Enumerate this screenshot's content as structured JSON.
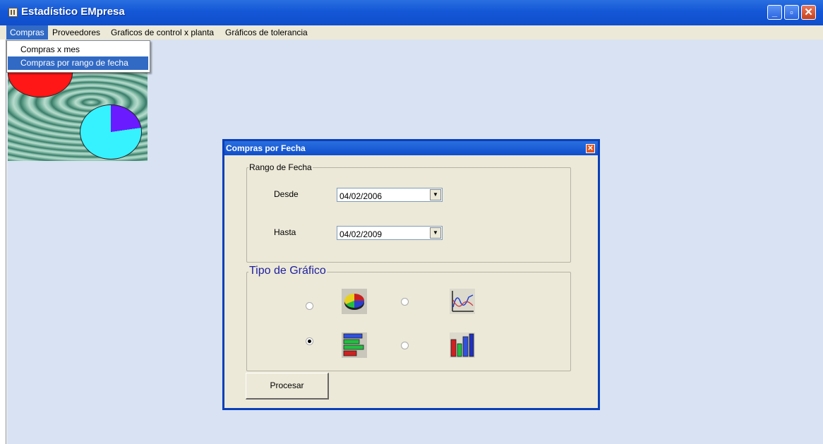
{
  "window": {
    "title": "Estadístico EMpresa"
  },
  "window_controls": {
    "minimize": "_",
    "restore": "▫",
    "close": "✕"
  },
  "menu": {
    "compras": "Compras",
    "proveedores": "Proveedores",
    "graficos_control": "Graficos de control x planta",
    "graficos_tolerancia": "Gráficos de tolerancia"
  },
  "dropdown": {
    "items": [
      "Compras x mes",
      "Compras por rango de fecha"
    ],
    "selected_index": 1
  },
  "dialog": {
    "title": "Compras por Fecha",
    "close": "✕",
    "rango": {
      "legend": "Rango de Fecha",
      "desde_label": "Desde",
      "desde_value": "04/02/2006",
      "hasta_label": "Hasta",
      "hasta_value": "04/02/2009"
    },
    "tipo": {
      "legend": "Tipo de Gráfico",
      "options": [
        {
          "icon": "pie-chart-icon",
          "checked": false
        },
        {
          "icon": "line-chart-icon",
          "checked": false
        },
        {
          "icon": "horizontal-bar-chart-icon",
          "checked": true
        },
        {
          "icon": "vertical-bar-chart-icon",
          "checked": false
        }
      ]
    },
    "procesar": "Procesar"
  },
  "colors": {
    "titlebar": "#0f4ecc",
    "client": "#d8e2f2",
    "dialog_face": "#ece9d8",
    "menu_highlight": "#316ac5"
  }
}
